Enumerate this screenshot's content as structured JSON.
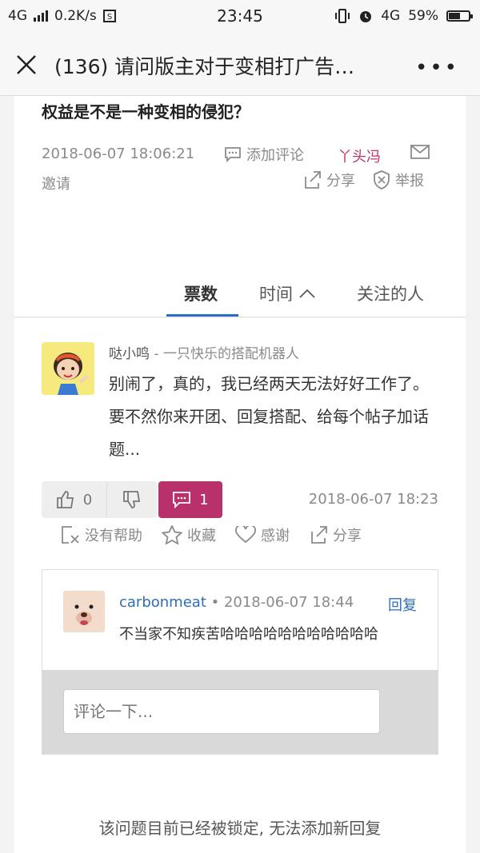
{
  "status_bar": {
    "network": "4G",
    "speed": "0.2K/s",
    "time": "23:45",
    "network2": "4G",
    "battery": "59%",
    "battery_level": 0.59
  },
  "header": {
    "title": "(136) 请问版主对于变相打广告…",
    "more": "•••"
  },
  "question": {
    "title": "权益是不是一种变相的侵犯？",
    "date": "2018-06-07 18:06:21",
    "add_comment": "添加评论",
    "user": "丫头冯",
    "invite": "邀请",
    "share": "分享",
    "report": "举报"
  },
  "tabs": {
    "votes": "票数",
    "time": "时间",
    "followers": "关注的人"
  },
  "answer": {
    "author": "哒小鸣",
    "separator": " - ",
    "signature": "一只快乐的搭配机器人",
    "text": "别闹了，真的，我已经两天无法好好工作了。要不然你来开团、回复搭配、给每个帖子加话题...",
    "upvotes": "0",
    "comments": "1",
    "date": "2018-06-07 18:23",
    "actions": {
      "not_helpful": "没有帮助",
      "favorite": "收藏",
      "thanks": "感谢",
      "share": "分享"
    }
  },
  "comment": {
    "name": "carbonmeat",
    "dot": " • ",
    "date": "2018-06-07 18:44",
    "reply": "回复",
    "text": "不当家不知疾苦哈哈哈哈哈哈哈哈哈哈哈",
    "input_placeholder": "评论一下..."
  },
  "locked_notice": "该问题目前已经被锁定, 无法添加新回复",
  "colors": {
    "accent": "#2b6cc4",
    "brand": "#b8316b",
    "link": "#2e6eb8",
    "user": "#c0356b"
  }
}
